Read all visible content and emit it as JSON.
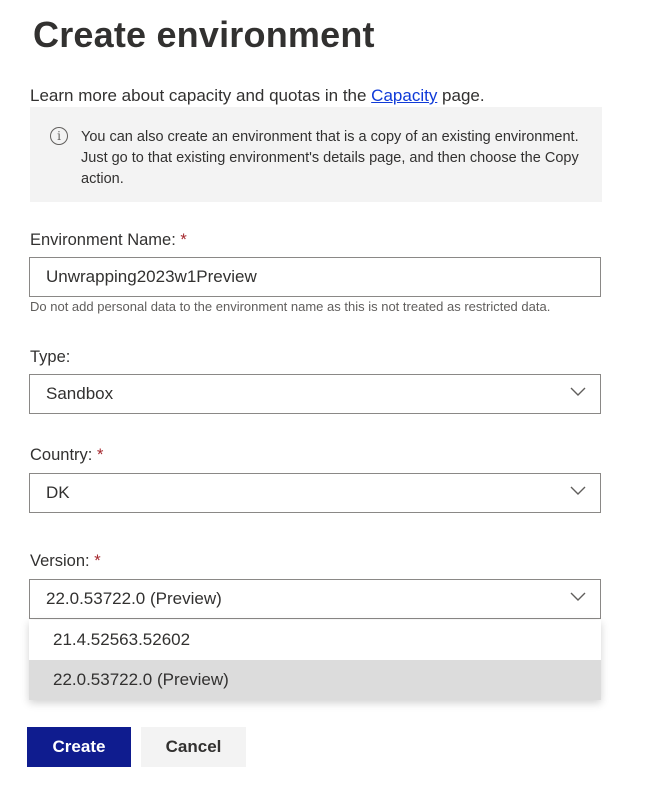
{
  "page": {
    "title": "Create environment",
    "intro_prefix": "Learn more about capacity and quotas in the ",
    "intro_link": "Capacity",
    "intro_suffix": " page."
  },
  "info": {
    "icon": "info-icon",
    "text": "You can also create an environment that is a copy of an existing environment. Just go to that existing environment's details page, and then choose the Copy action."
  },
  "form": {
    "required_marker": "*",
    "env_name": {
      "label": "Environment Name: ",
      "value": "Unwrapping2023w1Preview",
      "hint": "Do not add personal data to the environment name as this is not treated as restricted data."
    },
    "type": {
      "label": "Type:",
      "value": "Sandbox"
    },
    "country": {
      "label": "Country: ",
      "value": "DK"
    },
    "version": {
      "label": "Version: ",
      "value": "22.0.53722.0 (Preview)",
      "options": [
        "21.4.52563.52602",
        "22.0.53722.0 (Preview)"
      ]
    }
  },
  "actions": {
    "create": "Create",
    "cancel": "Cancel"
  },
  "colors": {
    "primary": "#0f1c8f",
    "link": "#0f3ad8",
    "required": "#a4262c",
    "info_bg": "#f3f3f3"
  }
}
